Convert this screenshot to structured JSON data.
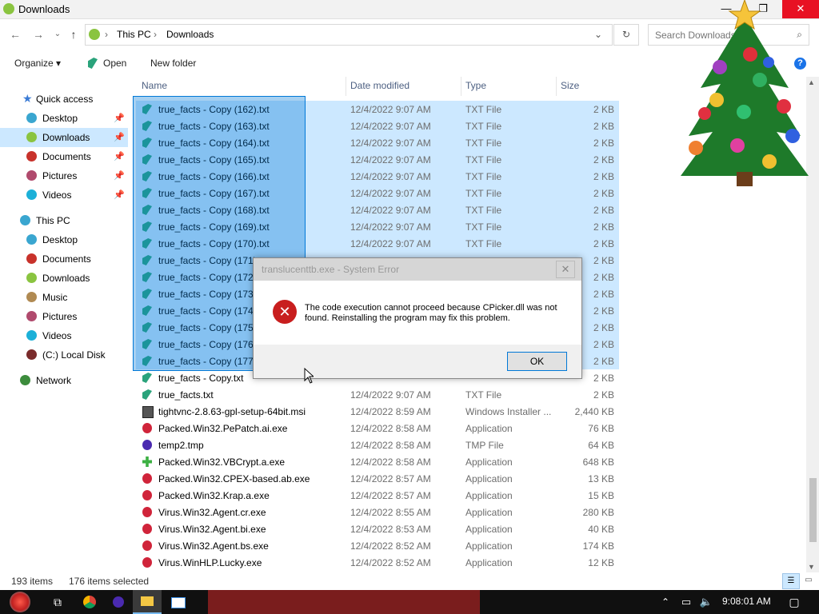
{
  "window": {
    "title": "Downloads",
    "minimize": "—",
    "maximize": "❐",
    "close": "✕"
  },
  "nav": {
    "back": "←",
    "forward": "→",
    "recent": "⌄",
    "up": "↑",
    "breadcrumb": [
      "This PC",
      "Downloads"
    ],
    "refresh": "↻",
    "search_placeholder": "Search Downloads"
  },
  "commands": {
    "organize": "Organize",
    "open": "Open",
    "new_folder": "New folder"
  },
  "sidebar": {
    "quick_access": "Quick access",
    "quick_items": [
      "Desktop",
      "Downloads",
      "Documents",
      "Pictures",
      "Videos"
    ],
    "this_pc": "This PC",
    "pc_items": [
      "Desktop",
      "Documents",
      "Downloads",
      "Music",
      "Pictures",
      "Videos",
      "(C:) Local Disk"
    ],
    "network": "Network"
  },
  "columns": {
    "name": "Name",
    "date": "Date modified",
    "type": "Type",
    "size": "Size"
  },
  "files": [
    {
      "name": "true_facts - Copy (162).txt",
      "date": "12/4/2022 9:07 AM",
      "type": "TXT File",
      "size": "2 KB",
      "selected": true
    },
    {
      "name": "true_facts - Copy (163).txt",
      "date": "12/4/2022 9:07 AM",
      "type": "TXT File",
      "size": "2 KB",
      "selected": true
    },
    {
      "name": "true_facts - Copy (164).txt",
      "date": "12/4/2022 9:07 AM",
      "type": "TXT File",
      "size": "2 KB",
      "selected": true
    },
    {
      "name": "true_facts - Copy (165).txt",
      "date": "12/4/2022 9:07 AM",
      "type": "TXT File",
      "size": "2 KB",
      "selected": true
    },
    {
      "name": "true_facts - Copy (166).txt",
      "date": "12/4/2022 9:07 AM",
      "type": "TXT File",
      "size": "2 KB",
      "selected": true
    },
    {
      "name": "true_facts - Copy (167).txt",
      "date": "12/4/2022 9:07 AM",
      "type": "TXT File",
      "size": "2 KB",
      "selected": true
    },
    {
      "name": "true_facts - Copy (168).txt",
      "date": "12/4/2022 9:07 AM",
      "type": "TXT File",
      "size": "2 KB",
      "selected": true
    },
    {
      "name": "true_facts - Copy (169).txt",
      "date": "12/4/2022 9:07 AM",
      "type": "TXT File",
      "size": "2 KB",
      "selected": true
    },
    {
      "name": "true_facts - Copy (170).txt",
      "date": "12/4/2022 9:07 AM",
      "type": "TXT File",
      "size": "2 KB",
      "selected": true
    },
    {
      "name": "true_facts - Copy (171)",
      "date": "",
      "type": "",
      "size": "2 KB",
      "selected": true
    },
    {
      "name": "true_facts - Copy (172)",
      "date": "",
      "type": "",
      "size": "2 KB",
      "selected": true
    },
    {
      "name": "true_facts - Copy (173)",
      "date": "",
      "type": "",
      "size": "2 KB",
      "selected": true
    },
    {
      "name": "true_facts - Copy (174)",
      "date": "",
      "type": "",
      "size": "2 KB",
      "selected": true
    },
    {
      "name": "true_facts - Copy (175)",
      "date": "",
      "type": "",
      "size": "2 KB",
      "selected": true
    },
    {
      "name": "true_facts - Copy (176)",
      "date": "",
      "type": "",
      "size": "2 KB",
      "selected": true
    },
    {
      "name": "true_facts - Copy (177)",
      "date": "",
      "type": "",
      "size": "2 KB",
      "selected": true
    },
    {
      "name": "true_facts - Copy.txt",
      "date": "",
      "type": "",
      "size": "2 KB",
      "selected": false
    },
    {
      "name": "true_facts.txt",
      "date": "12/4/2022 9:07 AM",
      "type": "TXT File",
      "size": "2 KB",
      "selected": false
    },
    {
      "name": "tightvnc-2.8.63-gpl-setup-64bit.msi",
      "date": "12/4/2022 8:59 AM",
      "type": "Windows Installer ...",
      "size": "2,440 KB",
      "selected": false
    },
    {
      "name": "Packed.Win32.PePatch.ai.exe",
      "date": "12/4/2022 8:58 AM",
      "type": "Application",
      "size": "76 KB",
      "selected": false
    },
    {
      "name": "temp2.tmp",
      "date": "12/4/2022 8:58 AM",
      "type": "TMP File",
      "size": "64 KB",
      "selected": false
    },
    {
      "name": "Packed.Win32.VBCrypt.a.exe",
      "date": "12/4/2022 8:58 AM",
      "type": "Application",
      "size": "648 KB",
      "selected": false
    },
    {
      "name": "Packed.Win32.CPEX-based.ab.exe",
      "date": "12/4/2022 8:57 AM",
      "type": "Application",
      "size": "13 KB",
      "selected": false
    },
    {
      "name": "Packed.Win32.Krap.a.exe",
      "date": "12/4/2022 8:57 AM",
      "type": "Application",
      "size": "15 KB",
      "selected": false
    },
    {
      "name": "Virus.Win32.Agent.cr.exe",
      "date": "12/4/2022 8:55 AM",
      "type": "Application",
      "size": "280 KB",
      "selected": false
    },
    {
      "name": "Virus.Win32.Agent.bi.exe",
      "date": "12/4/2022 8:53 AM",
      "type": "Application",
      "size": "40 KB",
      "selected": false
    },
    {
      "name": "Virus.Win32.Agent.bs.exe",
      "date": "12/4/2022 8:52 AM",
      "type": "Application",
      "size": "174 KB",
      "selected": false
    },
    {
      "name": "Virus.WinHLP.Lucky.exe",
      "date": "12/4/2022 8:52 AM",
      "type": "Application",
      "size": "12 KB",
      "selected": false
    }
  ],
  "dialog": {
    "title": "translucenttb.exe - System Error",
    "close": "✕",
    "message": "The code execution cannot proceed because CPicker.dll was not found. Reinstalling the program may fix this problem.",
    "ok": "OK",
    "icon": "error-icon"
  },
  "status": {
    "items": "193 items",
    "selected": "176 items selected"
  },
  "taskbar": {
    "time": "9:08:01 AM"
  }
}
